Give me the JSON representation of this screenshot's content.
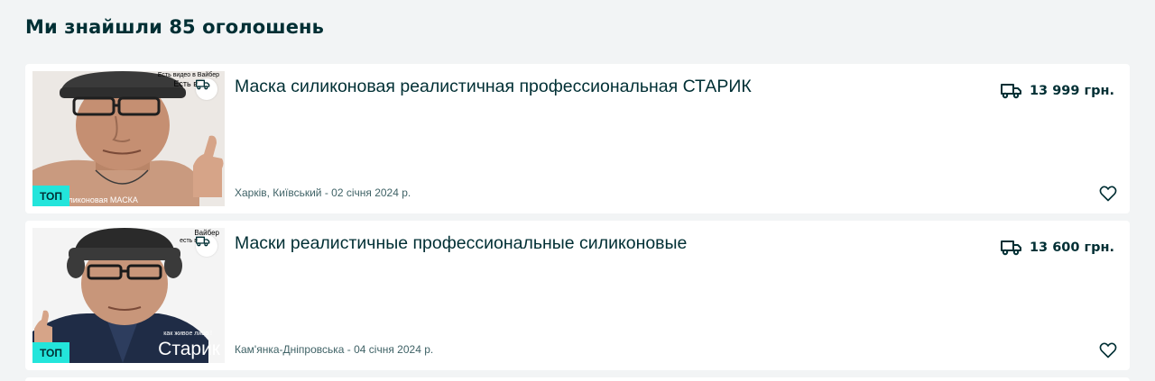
{
  "results": {
    "heading": "Ми знайшли 85 оголошень"
  },
  "listings": [
    {
      "title": "Маска силиконовая реалистичная професcиональная СТАРИК",
      "price": "13 999 грн.",
      "location_date": "Харків, Київський - 02 січня 2024 р.",
      "badge": "ТОП",
      "image_caption_top": "Есть видео в Вайбер",
      "image_caption_top2": "Есть в",
      "image_caption_bottom": "силиконовая МАСКА"
    },
    {
      "title": "Маски реалистичные профессиональные силиконовые",
      "price": "13 600 грн.",
      "location_date": "Кам'янка-Дніпровська - 04 січня 2024 р.",
      "badge": "ТОП",
      "image_caption_top": "Вайбер",
      "image_caption_top2": "есть в",
      "image_caption_small": "как живое лицо !",
      "image_caption_big": "Старик"
    }
  ],
  "icons": {
    "delivery": "truck-icon",
    "favorite": "heart-icon"
  },
  "colors": {
    "badge": "#23e5db",
    "text": "#002f34",
    "background": "#f2f4f5"
  }
}
